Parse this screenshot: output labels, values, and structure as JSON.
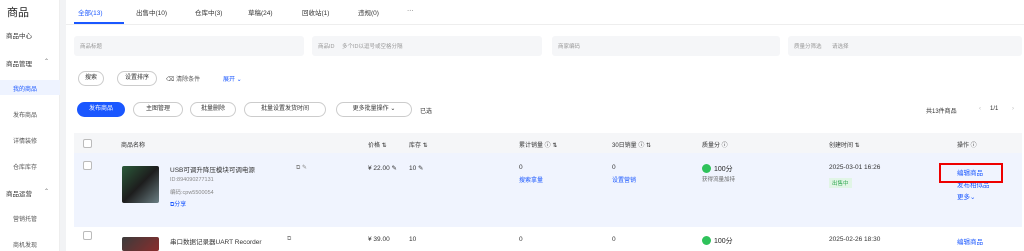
{
  "sidebar": {
    "title": "商品",
    "center": "商品中心",
    "manage": "商品管理",
    "my_goods": "我的商品",
    "publish": "发布商品",
    "detail": "详情装修",
    "warehouse": "仓库库存",
    "ops": "商品运营",
    "marketing": "营销托管",
    "ship": "商机发现"
  },
  "tabs": [
    "全部(13)",
    "出售中(10)",
    "仓库中(3)",
    "草稿(24)",
    "回收站(1)",
    "违规(0)",
    "···"
  ],
  "filters": {
    "title_label": "商品标题",
    "id_label": "商品ID",
    "id_placeholder": "多个ID以逗号或空格分隔",
    "code_label": "商家编码",
    "quality_label": "质量分筛选",
    "quality_placeholder": "请选择"
  },
  "actions": {
    "search": "搜索",
    "sort": "设置排序",
    "clear": "清除条件",
    "expand": "展开",
    "publish": "发布商品",
    "main_image": "主图管理",
    "batch_delete": "批量删除",
    "batch_ship": "批量设置发货时间",
    "more_batch": "更多批量操作",
    "selected": "已选",
    "total": "共13件商品",
    "pager": "1/1"
  },
  "columns": [
    "商品名称",
    "价格",
    "库存",
    "累计销量",
    "30日销量",
    "质量分",
    "创建时间",
    "操作"
  ],
  "rows": [
    {
      "name": "USB可调升降压模块可调电源",
      "id": "ID:894090277131",
      "code": "编码:cpw5500054",
      "share": "分享",
      "price": "¥ 22.00",
      "stock": "10",
      "sales": "0",
      "sales_link": "搜索拿量",
      "sales30": "0",
      "sales30_link": "设置营销",
      "score": "100分",
      "score_note": "获得流量加持",
      "created": "2025-03-01 16:26",
      "status": "出售中",
      "op_edit": "编辑商品",
      "op_similar": "发布相似品",
      "op_more": "更多"
    },
    {
      "name": "串口数据记录器UART Recorder",
      "price": "¥ 39.00",
      "stock": "10",
      "sales": "0",
      "sales30": "0",
      "score": "100分",
      "created": "2025-02-26 18:30",
      "op_edit": "编辑商品"
    }
  ]
}
